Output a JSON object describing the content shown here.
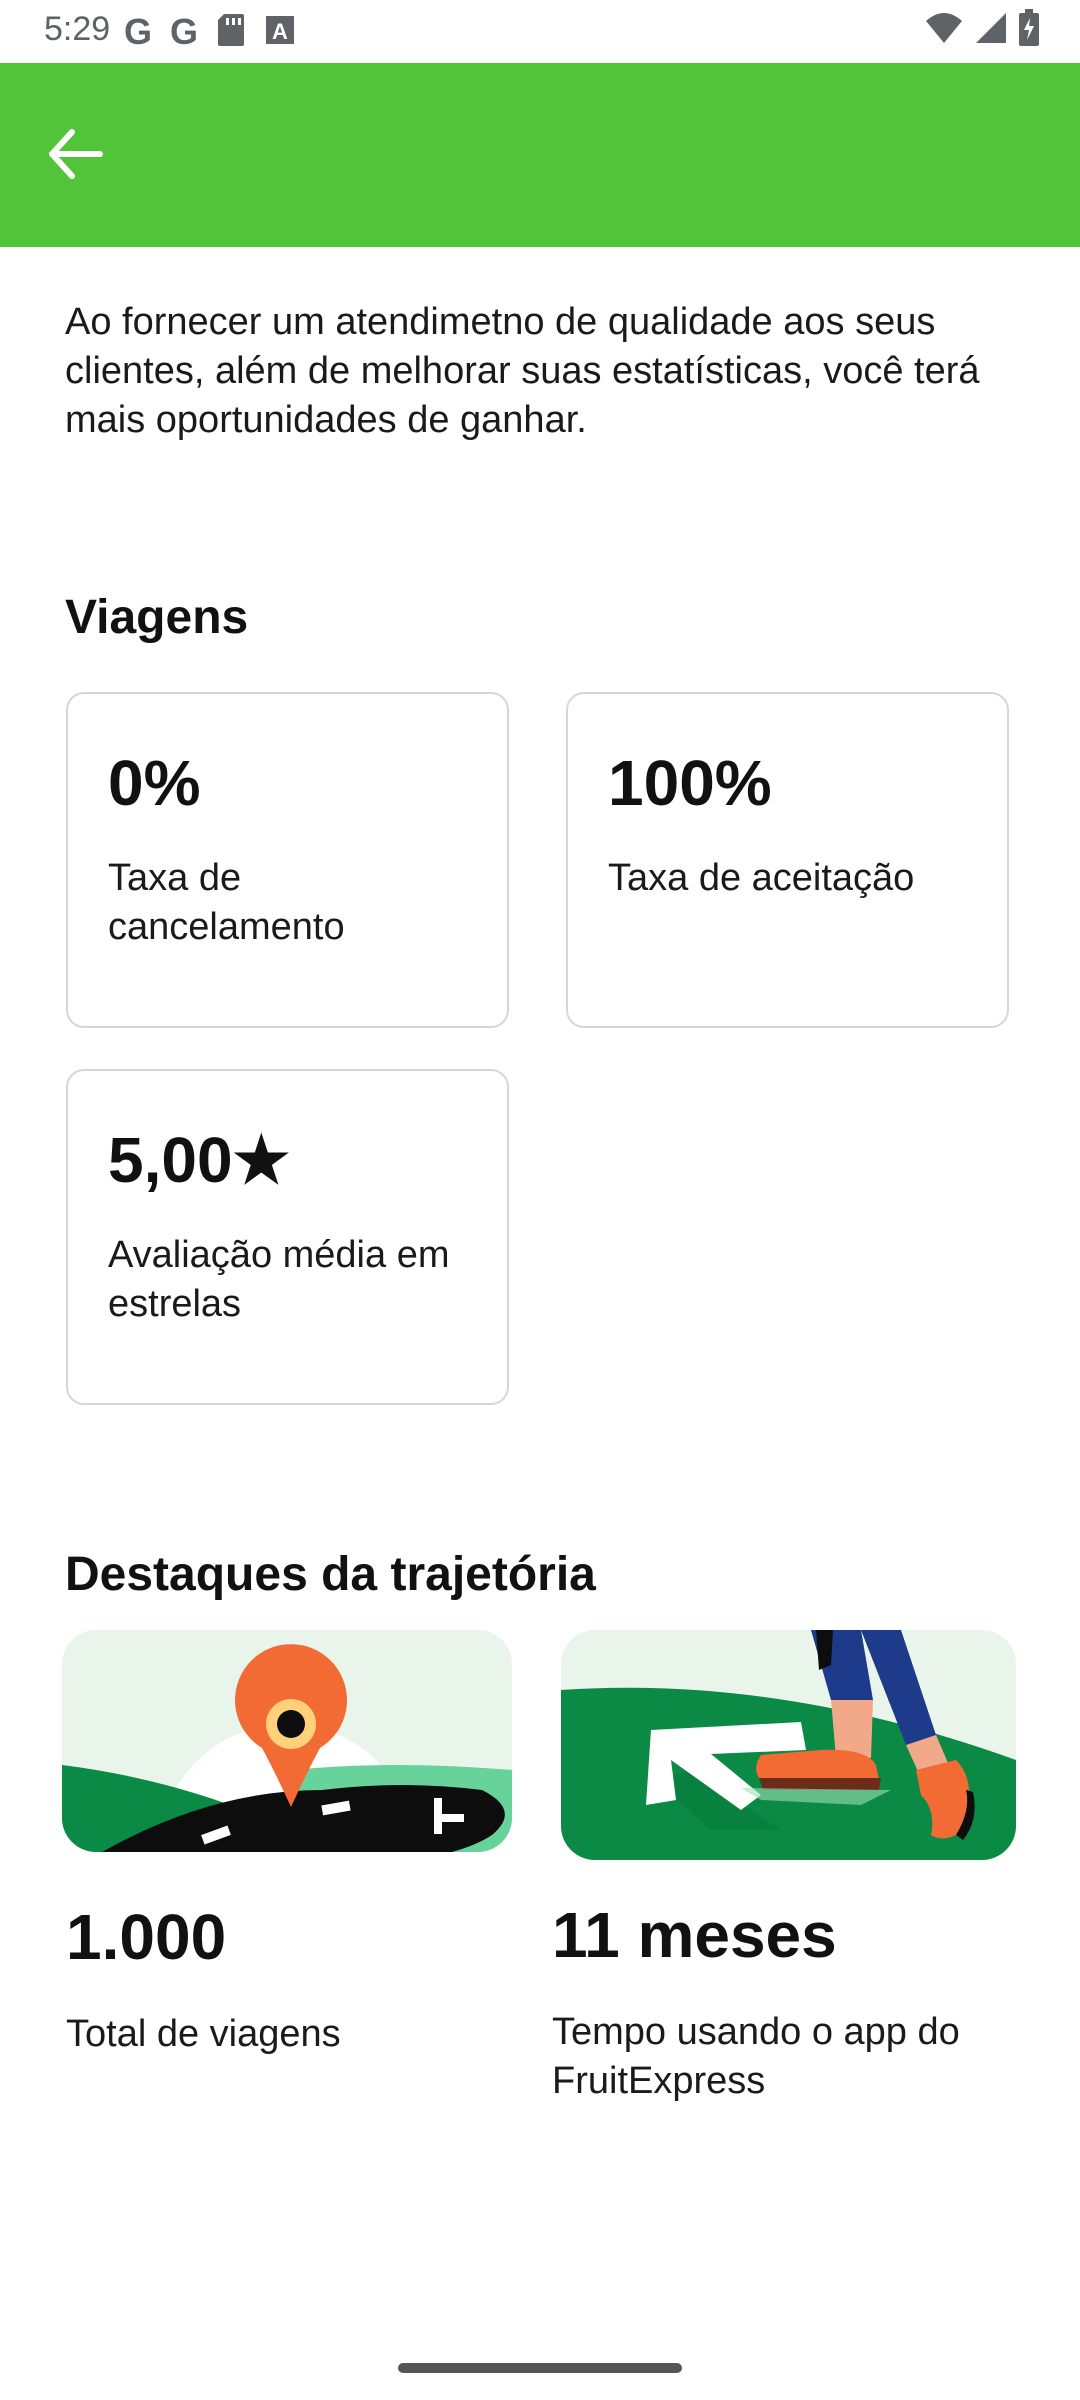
{
  "status_bar": {
    "time": "5:29",
    "left_icons": [
      "google-icon",
      "google-icon",
      "sd-card-icon",
      "font-a-icon"
    ],
    "right_icons": [
      "wifi-icon",
      "signal-icon",
      "battery-charging-icon"
    ]
  },
  "app_bar": {
    "back_icon": "arrow-back-icon",
    "color": "#52c43a"
  },
  "intro": {
    "text": "Ao fornecer um atendimetno de qualidade aos seus clientes, além de melhorar suas estatísticas, você terá mais oportunidades de ganhar."
  },
  "trips": {
    "title": "Viagens",
    "cards": [
      {
        "value": "0%",
        "label": "Taxa de cancelamento"
      },
      {
        "value": "100%",
        "label": "Taxa de aceitação"
      },
      {
        "value": "5,00★",
        "label": "Avaliação média em estrelas"
      }
    ]
  },
  "highlights": {
    "title": "Destaques da trajetória",
    "items": [
      {
        "value": "1.000",
        "label": "Total de viagens",
        "image": "map-pin-road-illustration"
      },
      {
        "value": "11 meses",
        "label": "Tempo usando o app do FruitExpress",
        "image": "walking-arrow-illustration"
      }
    ]
  },
  "colors": {
    "accent_green": "#52c43a",
    "illustration_dark_green": "#0a8a45",
    "illustration_light_green": "#67d39b",
    "pin_orange": "#f26b35"
  }
}
